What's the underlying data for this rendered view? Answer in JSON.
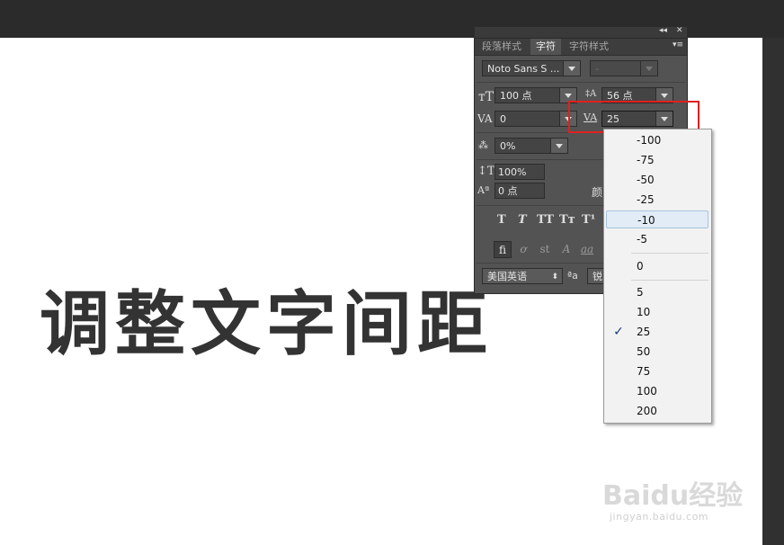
{
  "canvas_text": "调整文字间距",
  "panel": {
    "tabs": [
      "段落样式",
      "字符",
      "字符样式"
    ],
    "font_family": "Noto Sans S ...",
    "font_style": "-",
    "font_size": "100 点",
    "leading": "56 点",
    "kerning": "0",
    "tracking": "25",
    "tsume": "0%",
    "vertical_scale": "100%",
    "baseline_shift": "0 点",
    "color_label": "颜",
    "type_buttons": [
      "T",
      "T",
      "TT",
      "Tт",
      "T¹"
    ],
    "opentype_buttons": [
      "fi",
      "ơ",
      "st",
      "A",
      "aa"
    ],
    "language": "美国英语",
    "aa_icon": "ªa",
    "antialias": "锐"
  },
  "tracking_options": {
    "group1": [
      "-100",
      "-75",
      "-50",
      "-25",
      "-10",
      "-5"
    ],
    "group2": [
      "0"
    ],
    "group3": [
      "5",
      "10",
      "25",
      "50",
      "75",
      "100",
      "200"
    ],
    "selected": "25",
    "hovered": "-10"
  },
  "watermark": {
    "brand": "Baidu经验",
    "url": "jingyan.baidu.com"
  }
}
